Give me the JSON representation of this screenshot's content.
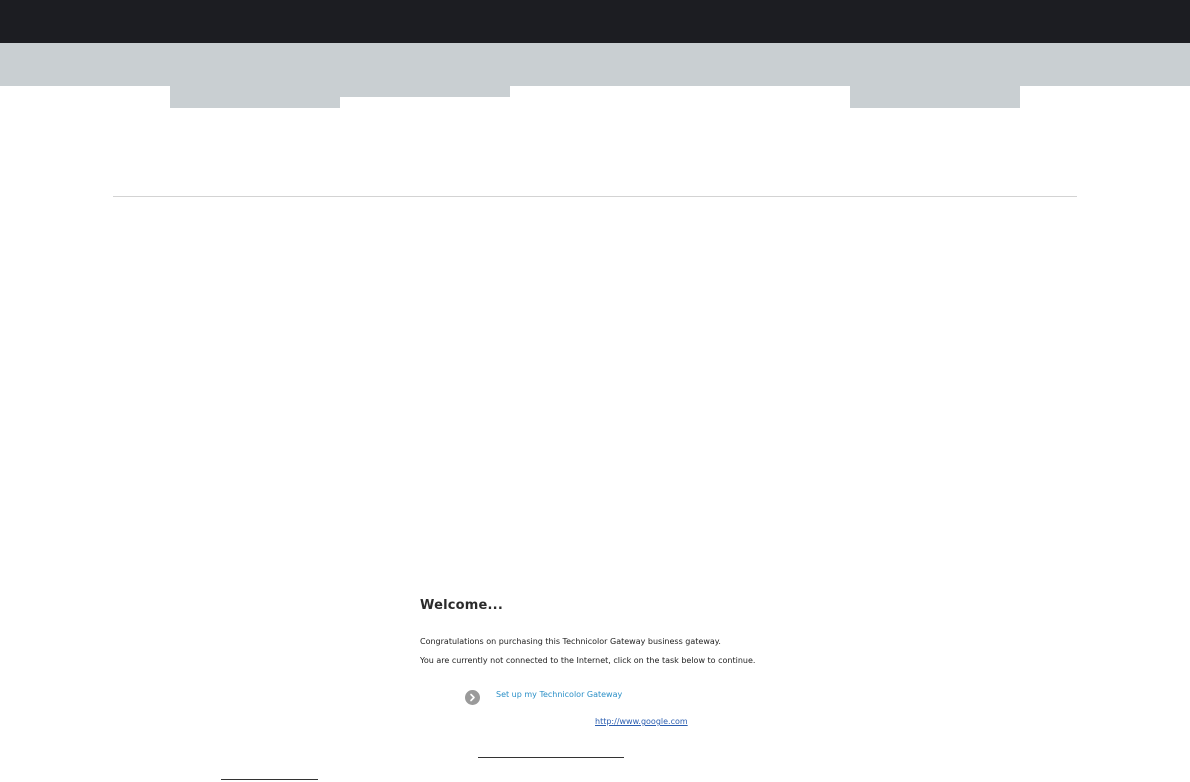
{
  "welcome": {
    "title": "Welcome...",
    "line1": "Congratulations on purchasing this Technicolor Gateway business gateway.",
    "line2": "You are currently not connected to the Internet, click on the task below to continue."
  },
  "tasks": {
    "setup_label": "Set up my Technicolor Gateway",
    "icon": "chevron-right-icon"
  },
  "link": {
    "url_label": "http://www.google.com"
  },
  "colors": {
    "topbar": "#1c1d22",
    "band": "#c9cfd2",
    "link": "#2a8fc7"
  }
}
